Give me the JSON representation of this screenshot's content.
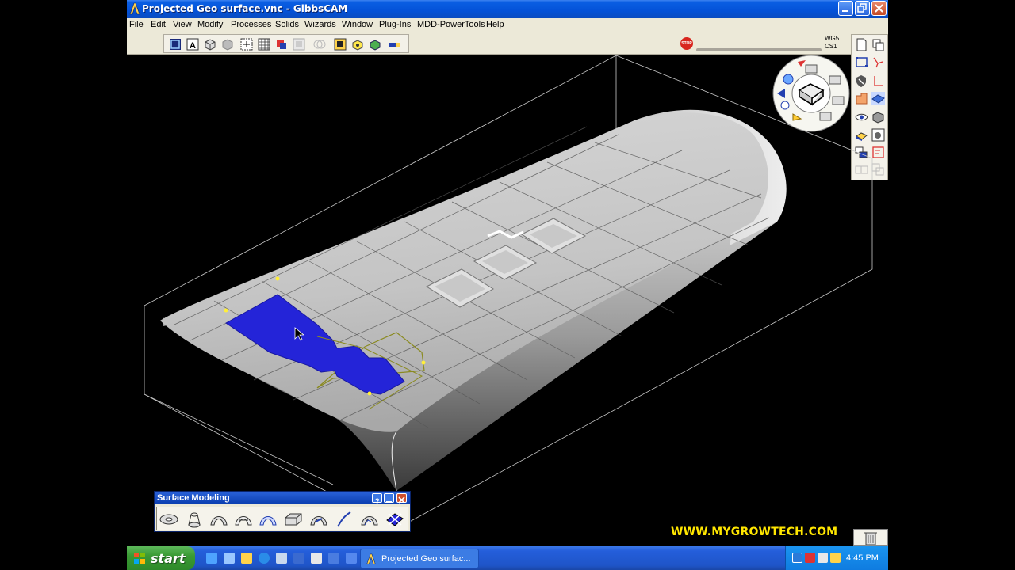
{
  "window": {
    "title": "Projected Geo surface.vnc - GibbsCAM"
  },
  "menu": [
    "File",
    "Edit",
    "View",
    "Modify",
    "Processes",
    "Solids",
    "Wizards",
    "Window",
    "Plug-Ins",
    "MDD-PowerTools",
    "Help"
  ],
  "toolbar": {
    "buttons": [
      "wireframe-view",
      "annotation",
      "box-view",
      "shaded-view",
      "select-points",
      "grid",
      "flip",
      "hidden",
      "circle",
      "cube-yellow",
      "cube-green",
      "flat-bar"
    ],
    "status": {
      "wcs": "WG5",
      "cs": "CS1"
    }
  },
  "palette": {
    "title": "Surface Modeling",
    "tools": [
      "revolve-surface",
      "loft-surface",
      "sweep-surface",
      "sweep-two-rails",
      "ruled-surface",
      "extrude-surface",
      "fillet-surface",
      "curve-tool",
      "patch-surface",
      "project-geometry"
    ]
  },
  "watermark": "WWW.MYGROWTECH.COM",
  "taskbar": {
    "start_label": "start",
    "task_label": "Projected Geo surfac...",
    "clock": "4:45 PM"
  },
  "colors": {
    "titlebar": "#0452d8",
    "selection": "#2424d8",
    "watermark": "#ffe600",
    "grid": "#c0c0c0"
  }
}
